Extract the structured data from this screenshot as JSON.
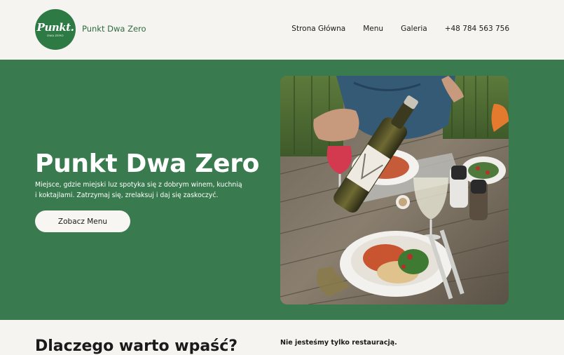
{
  "brand": {
    "logo_text": "Punkt.",
    "logo_subtext": "DWA ZERO",
    "name": "Punkt Dwa Zero"
  },
  "nav": {
    "items": [
      {
        "label": "Strona Główna"
      },
      {
        "label": "Menu"
      },
      {
        "label": "Galeria"
      },
      {
        "label": "+48 784 563 756"
      }
    ]
  },
  "hero": {
    "title": "Punkt Dwa Zero",
    "description": "Miejsce, gdzie miejski luz spotyka się z dobrym winem, kuchnią i koktajlami. Zatrzymaj się, zrelaksuj i daj się zaskoczyć.",
    "cta_label": "Zobacz Menu",
    "image_icon": "restaurant-photo"
  },
  "why": {
    "title": "Dlaczego warto wpaść?",
    "subtitle": "Nie jesteśmy tylko restauracją."
  },
  "colors": {
    "brand_green": "#2e7a44",
    "hero_bg": "#397a4e",
    "page_bg": "#f6f4f0"
  }
}
